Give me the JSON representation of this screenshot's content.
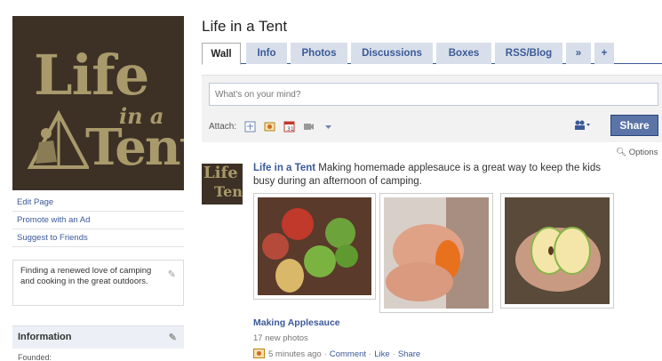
{
  "logo": {
    "line1": "Life",
    "line2": "in a",
    "line3": "Tent"
  },
  "page": {
    "title": "Life in a Tent"
  },
  "tabs": [
    {
      "label": "Wall"
    },
    {
      "label": "Info"
    },
    {
      "label": "Photos"
    },
    {
      "label": "Discussions"
    },
    {
      "label": "Boxes"
    },
    {
      "label": "RSS/Blog"
    },
    {
      "label": "»"
    },
    {
      "label": "+"
    }
  ],
  "sidebar": {
    "links": [
      {
        "label": "Edit Page"
      },
      {
        "label": "Promote with an Ad"
      },
      {
        "label": "Suggest to Friends"
      }
    ],
    "about": "Finding a renewed love of camping and cooking in the great outdoors.",
    "info_heading": "Information",
    "info_first_label": "Founded:"
  },
  "composer": {
    "placeholder": "What's on your mind?",
    "attach_label": "Attach:",
    "share_label": "Share"
  },
  "options_label": "Options",
  "story": {
    "actor": "Life in a Tent",
    "message": "Making homemade applesauce is a great way to keep the kids busy during an afternoon of camping.",
    "album_title": "Making Applesauce",
    "album_count": "17 new photos",
    "time": "5 minutes ago",
    "actions": [
      "Comment",
      "Like",
      "Share"
    ]
  },
  "colors": {
    "link": "#3b5998",
    "tab_bg": "#d8dfea",
    "share_button": "#5b74a8",
    "logo_bg": "#3d3126",
    "logo_text": "#a89a6a"
  }
}
